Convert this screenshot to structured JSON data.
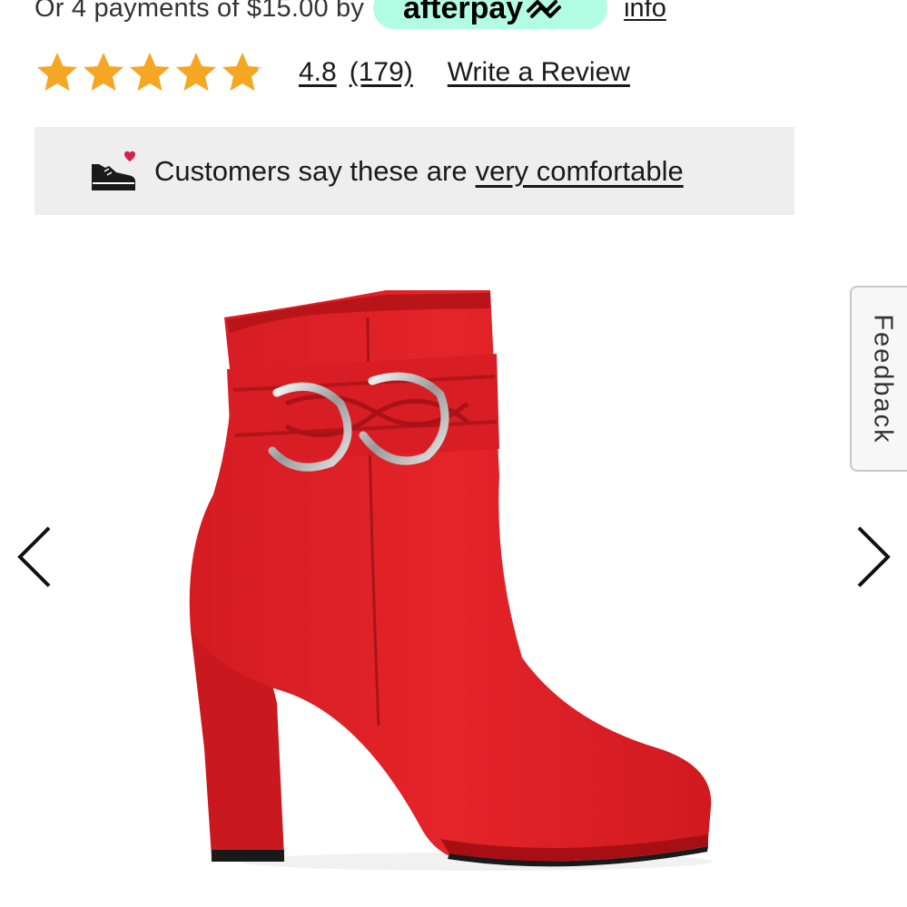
{
  "afterpay": {
    "payments_text": "Or 4 payments of $15.00 by",
    "brand": "afterpay",
    "info_link": "info",
    "badge_color": "#b2fce4"
  },
  "rating": {
    "stars": 4.8,
    "value": "4.8",
    "count": "(179)",
    "write_review": "Write a Review",
    "star_color": "#f5a623"
  },
  "comfort": {
    "icon": "sneaker-heart-icon",
    "text": "Customers say these are",
    "link": "very comfortable"
  },
  "carousel": {
    "prev_icon": "chevron-left-icon",
    "next_icon": "chevron-right-icon",
    "product_color": "#e02127"
  },
  "feedback": {
    "label": "Feedback"
  }
}
